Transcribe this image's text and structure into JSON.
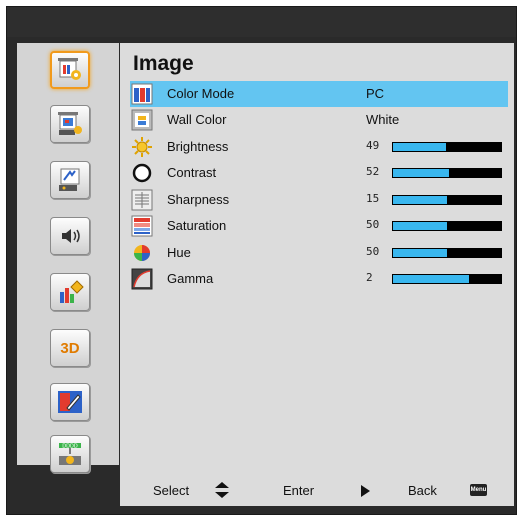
{
  "panel": {
    "title": "Image",
    "rows": [
      {
        "label": "Color Mode",
        "value": "PC"
      },
      {
        "label": "Wall Color",
        "value": "White"
      },
      {
        "label": "Brightness",
        "value": "49",
        "level": 49
      },
      {
        "label": "Contrast",
        "value": "52",
        "level": 52
      },
      {
        "label": "Sharpness",
        "value": "15",
        "level": 50
      },
      {
        "label": "Saturation",
        "value": "50",
        "level": 50
      },
      {
        "label": "Hue",
        "value": "50",
        "level": 50
      },
      {
        "label": "Gamma",
        "value": "2",
        "level": 70
      }
    ]
  },
  "footer": {
    "select": "Select",
    "enter": "Enter",
    "back": "Back",
    "menu_badge": "Menu"
  },
  "sidebar": {
    "items": [
      {
        "icon": "image-settings-icon"
      },
      {
        "icon": "display-settings-icon"
      },
      {
        "icon": "setup-icon"
      },
      {
        "icon": "volume-icon"
      },
      {
        "icon": "options-icon"
      },
      {
        "icon": "3d-icon",
        "label": "3D"
      },
      {
        "icon": "interactive-pen-icon"
      },
      {
        "icon": "network-icon"
      }
    ]
  },
  "colors": {
    "selection": "#63c5f1",
    "bar_fill": "#39b7ef",
    "active_border": "#f19a1c"
  }
}
